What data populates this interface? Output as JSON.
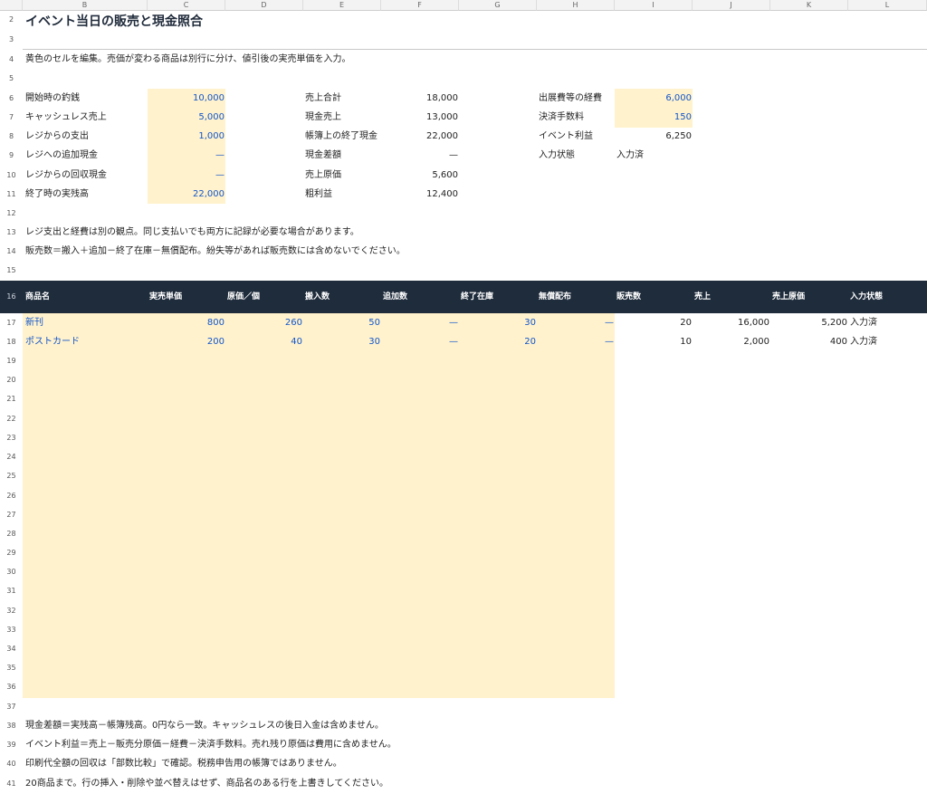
{
  "columns": [
    "B",
    "C",
    "D",
    "E",
    "F",
    "G",
    "H",
    "I",
    "J",
    "K",
    "L"
  ],
  "rows": [
    "2",
    "3",
    "4",
    "5",
    "6",
    "7",
    "8",
    "9",
    "10",
    "11",
    "12",
    "13",
    "14",
    "15",
    "16",
    "17",
    "18",
    "19",
    "20",
    "21",
    "22",
    "23",
    "24",
    "25",
    "26",
    "27",
    "28",
    "29",
    "30",
    "31",
    "32",
    "33",
    "34",
    "35",
    "36",
    "37",
    "38",
    "39",
    "40",
    "41"
  ],
  "title": "イベント当日の販売と現金照合",
  "instruction": "黄色のセルを編集。売価が変わる商品は別行に分け、値引後の実売単価を入力。",
  "cash_inputs": [
    {
      "label": "開始時の釣銭",
      "value": "10,000"
    },
    {
      "label": "キャッシュレス売上",
      "value": "5,000"
    },
    {
      "label": "レジからの支出",
      "value": "1,000"
    },
    {
      "label": "レジへの追加現金",
      "value": "—"
    },
    {
      "label": "レジからの回収現金",
      "value": "—"
    },
    {
      "label": "終了時の実残高",
      "value": "22,000"
    }
  ],
  "summary": [
    {
      "label": "売上合計",
      "value": "18,000"
    },
    {
      "label": "現金売上",
      "value": "13,000"
    },
    {
      "label": "帳簿上の終了現金",
      "value": "22,000"
    },
    {
      "label": "現金差額",
      "value": "—"
    },
    {
      "label": "売上原価",
      "value": "5,600"
    },
    {
      "label": "粗利益",
      "value": "12,400"
    }
  ],
  "expenses": [
    {
      "label": "出展費等の経費",
      "value": "6,000"
    },
    {
      "label": "決済手数料",
      "value": "150"
    },
    {
      "label": "イベント利益",
      "value": "6,250"
    },
    {
      "label": "入力状態",
      "value": "入力済"
    }
  ],
  "note13": "レジ支出と経費は別の観点。同じ支払いでも両方に記録が必要な場合があります。",
  "note14": "販売数＝搬入＋追加－終了在庫－無償配布。紛失等があれば販売数には含めないでください。",
  "table": {
    "headers": [
      "商品名",
      "実売単価",
      "原価／個",
      "搬入数",
      "追加数",
      "終了在庫",
      "無償配布",
      "販売数",
      "売上",
      "売上原価",
      "入力状態"
    ],
    "rows": [
      [
        "新刊",
        "800",
        "260",
        "50",
        "—",
        "30",
        "—",
        "20",
        "16,000",
        "5,200",
        "入力済"
      ],
      [
        "ポストカード",
        "200",
        "40",
        "30",
        "—",
        "20",
        "—",
        "10",
        "2,000",
        "400",
        "入力済"
      ]
    ]
  },
  "notes_bottom": [
    "現金差額＝実残高－帳簿残高。0円なら一致。キャッシュレスの後日入金は含めません。",
    "イベント利益＝売上－販売分原価－経費－決済手数料。売れ残り原価は費用に含めません。",
    "印刷代全額の回収は「部数比較」で確認。税務申告用の帳簿ではありません。",
    "20商品まで。行の挿入・削除や並べ替えはせず、商品名のある行を上書きしてください。"
  ],
  "colors": {
    "input_fill": "#fff2cc",
    "header_band": "#1f2c3c",
    "input_text": "#1155cc"
  }
}
